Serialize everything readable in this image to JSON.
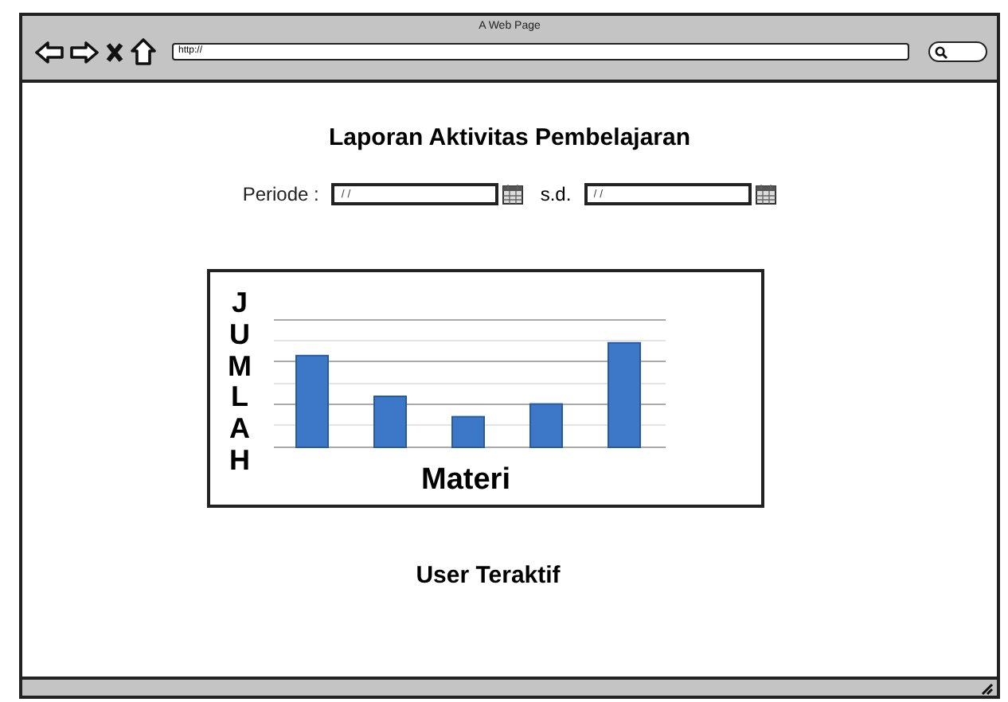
{
  "window": {
    "title": "A Web Page",
    "url": "http://"
  },
  "page": {
    "title": "Laporan Aktivitas Pembelajaran",
    "period": {
      "label": "Periode :",
      "from_placeholder": "/ /",
      "separator": "s.d.",
      "to_placeholder": "/ /"
    },
    "chart": {
      "ylabel": "JUMLAH",
      "xlabel": "Materi"
    },
    "section_title": "User Teraktif"
  }
}
